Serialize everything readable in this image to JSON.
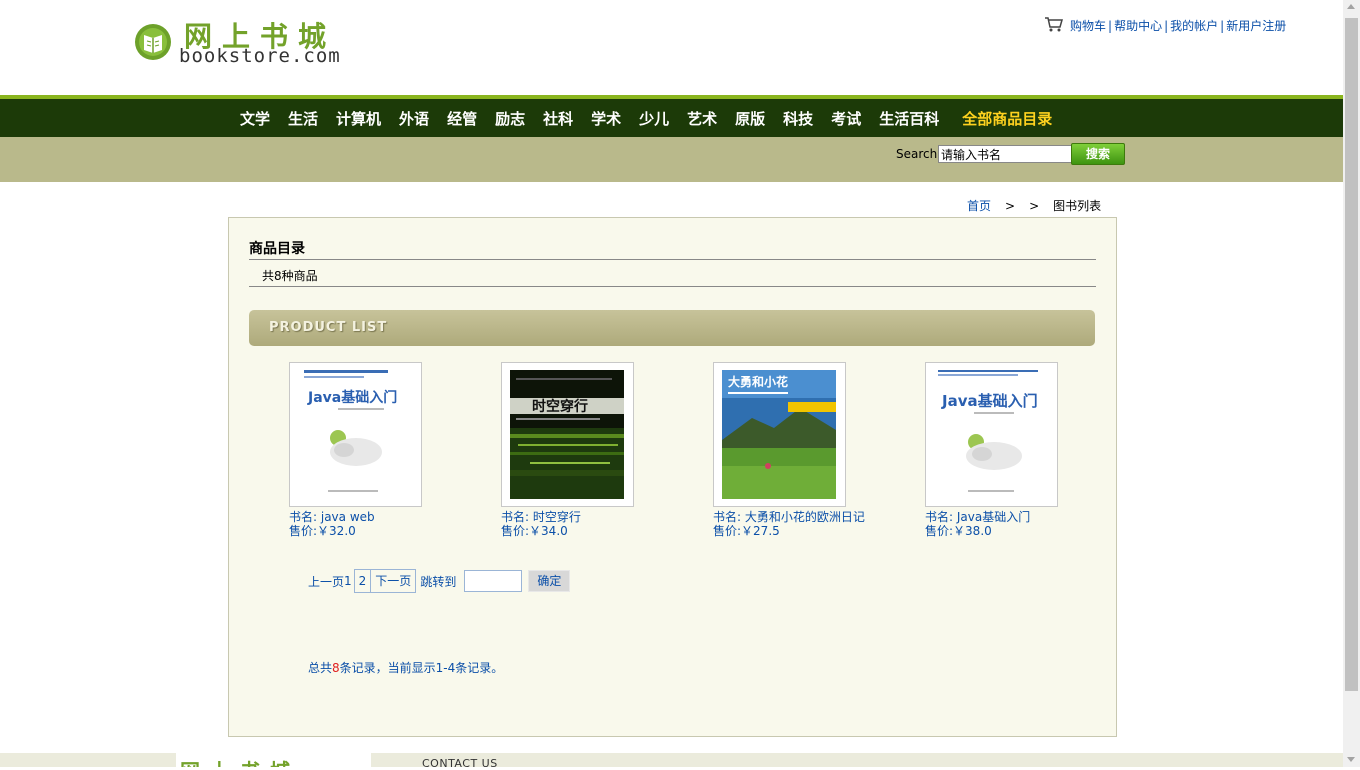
{
  "header": {
    "logo_cn": "网上书城",
    "logo_en": "bookstore.com",
    "links": [
      "购物车",
      "帮助中心",
      "我的帐户",
      "新用户注册"
    ],
    "separator": "|"
  },
  "nav": {
    "items": [
      "文学",
      "生活",
      "计算机",
      "外语",
      "经管",
      "励志",
      "社科",
      "学术",
      "少儿",
      "艺术",
      "原版",
      "科技",
      "考试",
      "生活百科"
    ],
    "all_label": "全部商品目录"
  },
  "search": {
    "label": "Search",
    "value": "请输入书名",
    "button": "搜索"
  },
  "breadcrumb": {
    "home": "首页",
    "gt": ">",
    "current": "图书列表"
  },
  "catalog": {
    "title": "商品目录",
    "count_text": "共8种商品",
    "list_header": "PRODUCT LIST"
  },
  "products": [
    {
      "name": "书名:  java web",
      "price": "售价:￥32.0",
      "cover_title": "Java基础入门"
    },
    {
      "name": "书名:  时空穿行",
      "price": "售价:￥34.0",
      "cover_title": "时空穿行"
    },
    {
      "name": "书名:  大勇和小花的欧洲日记",
      "price": "售价:￥27.5",
      "cover_title": "大勇和小花"
    },
    {
      "name": "书名:  Java基础入门",
      "price": "售价:￥38.0",
      "cover_title": "Java基础入门"
    }
  ],
  "pager": {
    "prev": "上一页",
    "page1": "1",
    "page2": "2",
    "next": "下一页",
    "jump_label": "跳转到",
    "confirm": "确定"
  },
  "records": {
    "prefix": "总共",
    "total": "8",
    "suffix": "条记录，当前显示1-4条记录。"
  },
  "footer": {
    "logo_cn": "网上书城",
    "contact": "CONTACT US"
  },
  "colors": {
    "nav_bg": "#1c3a08",
    "nav_accent": "#8ab51e",
    "search_bg": "#b9b98b",
    "link": "#0b4fa8",
    "all_items": "#ffd21f"
  }
}
